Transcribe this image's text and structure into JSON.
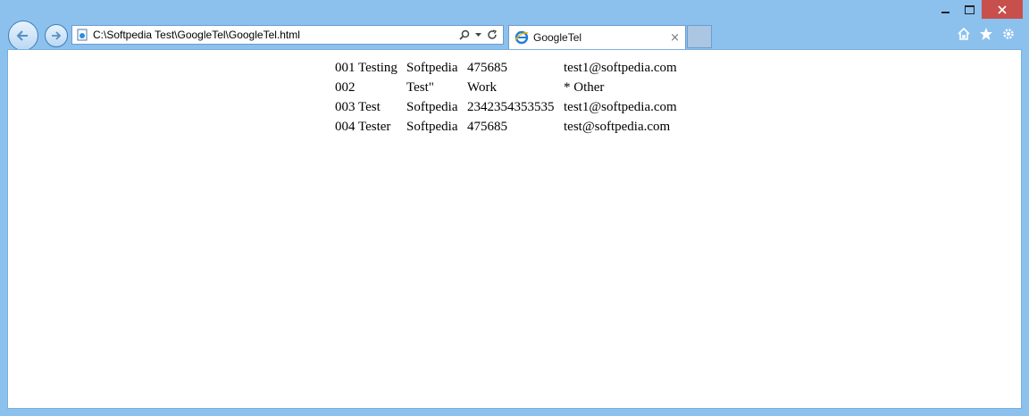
{
  "window": {
    "controls": {
      "minimize_icon": "minimize-icon",
      "maximize_icon": "maximize-icon",
      "close_icon": "close-icon"
    }
  },
  "navigation": {
    "back_icon": "back-arrow-icon",
    "forward_icon": "forward-arrow-icon"
  },
  "address_bar": {
    "url": "C:\\Softpedia Test\\GoogleTel\\GoogleTel.html",
    "tools": [
      "search-icon",
      "dropdown-icon",
      "refresh-icon"
    ]
  },
  "tab": {
    "title": "GoogleTel",
    "close": "×"
  },
  "toolbar_icons": [
    "home-icon",
    "favorites-star-icon",
    "settings-gear-icon"
  ],
  "colors": {
    "chrome_bg": "#8cc1ee",
    "close_button": "#c7504c"
  },
  "table": {
    "rows": [
      {
        "id": "001 Testing",
        "name": "Softpedia",
        "phone": "475685",
        "email": "test1@softpedia.com"
      },
      {
        "id": "002",
        "name": "Test\"",
        "phone": "Work",
        "email": "* Other"
      },
      {
        "id": "003 Test",
        "name": "Softpedia",
        "phone": "2342354353535",
        "email": "test1@softpedia.com"
      },
      {
        "id": "004 Tester",
        "name": "Softpedia",
        "phone": "475685",
        "email": "test@softpedia.com"
      }
    ]
  }
}
